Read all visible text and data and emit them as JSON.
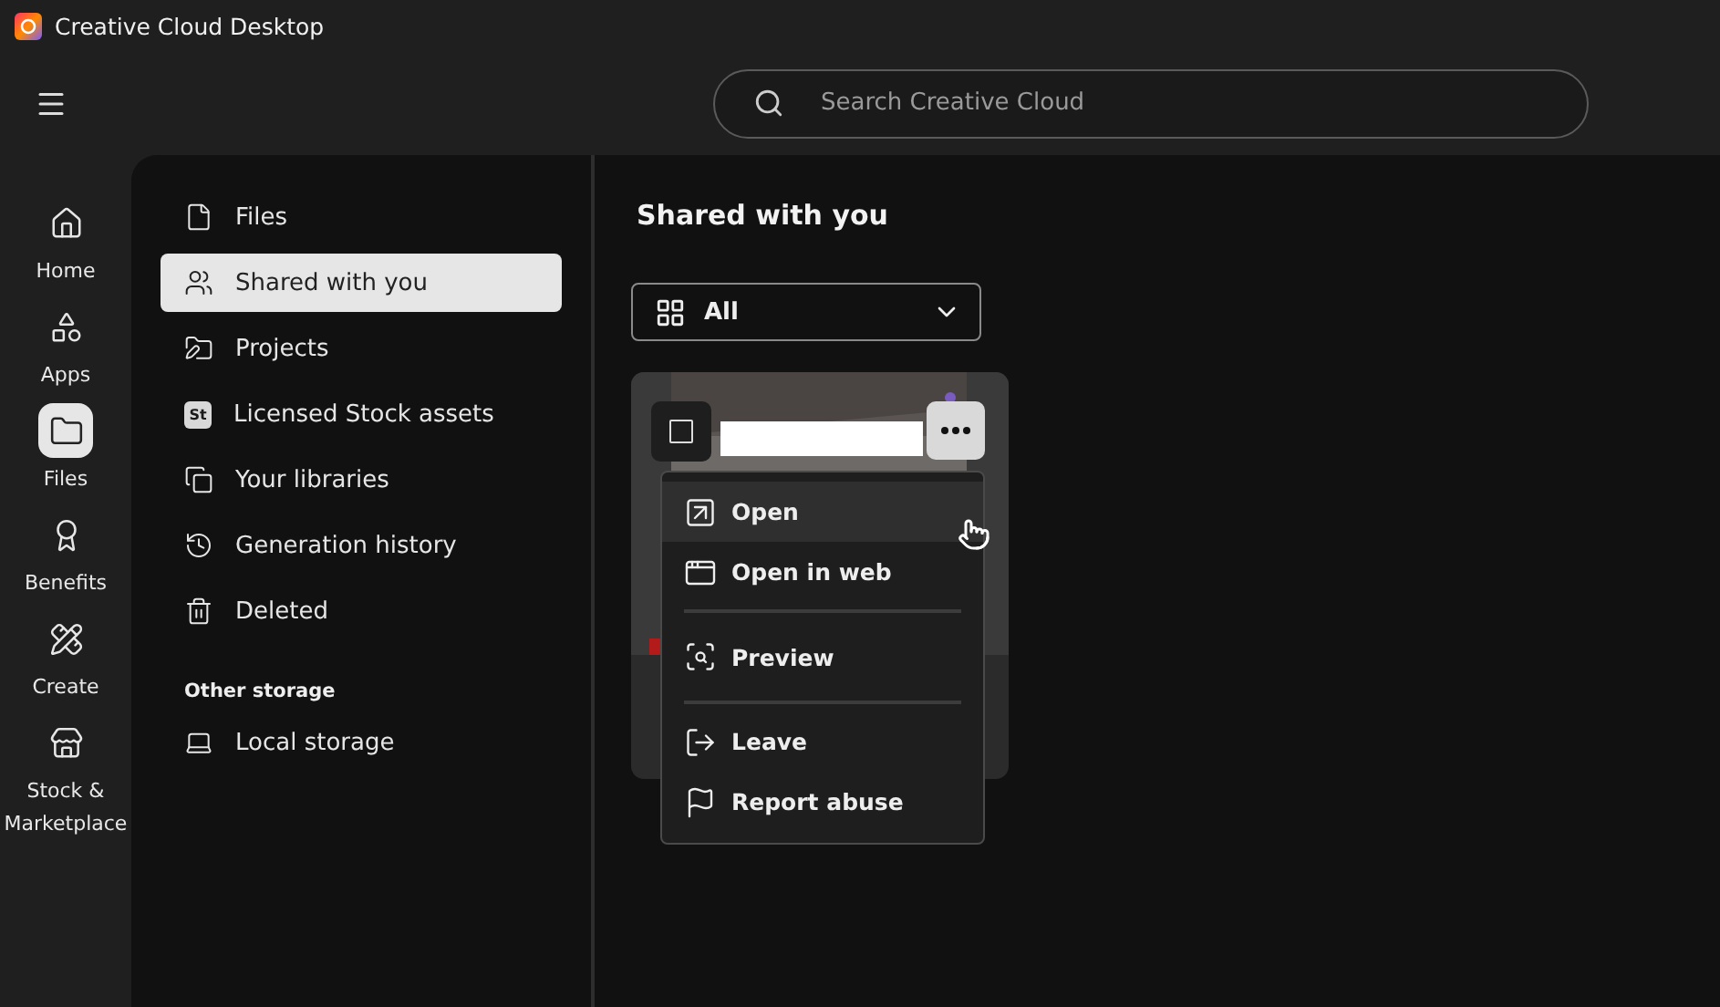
{
  "window": {
    "title": "Creative Cloud Desktop"
  },
  "search": {
    "placeholder": "Search Creative Cloud"
  },
  "rail": [
    {
      "kind": "home",
      "label": "Home",
      "selected": false
    },
    {
      "kind": "apps",
      "label": "Apps",
      "selected": false
    },
    {
      "kind": "files",
      "label": "Files",
      "selected": true
    },
    {
      "kind": "benefits",
      "label": "Benefits",
      "selected": false
    },
    {
      "kind": "create",
      "label": "Create",
      "selected": false
    },
    {
      "kind": "stock",
      "label": "Stock & Marketplace",
      "selected": false
    }
  ],
  "sidebar": {
    "items": [
      {
        "kind": "file",
        "label": "Files",
        "selected": false
      },
      {
        "kind": "shared",
        "label": "Shared with you",
        "selected": true
      },
      {
        "kind": "projects",
        "label": "Projects",
        "selected": false
      },
      {
        "kind": "stock",
        "badge": "St",
        "label": "Licensed Stock assets",
        "selected": false
      },
      {
        "kind": "libraries",
        "label": "Your libraries",
        "selected": false
      },
      {
        "kind": "history",
        "label": "Generation history",
        "selected": false
      },
      {
        "kind": "deleted",
        "label": "Deleted",
        "selected": false
      }
    ],
    "other_heading": "Other storage",
    "other_items": [
      {
        "kind": "local",
        "label": "Local storage",
        "selected": false
      }
    ]
  },
  "content": {
    "heading": "Shared with you",
    "filter": {
      "value": "All"
    },
    "card": {
      "checked": false,
      "menu": [
        {
          "kind": "open",
          "label": "Open",
          "hovered": true
        },
        {
          "kind": "web",
          "label": "Open in web",
          "hovered": false
        },
        {
          "kind": "divider"
        },
        {
          "kind": "preview",
          "label": "Preview",
          "hovered": false
        },
        {
          "kind": "divider"
        },
        {
          "kind": "leave",
          "label": "Leave",
          "hovered": false
        },
        {
          "kind": "report",
          "label": "Report abuse",
          "hovered": false
        }
      ]
    }
  }
}
